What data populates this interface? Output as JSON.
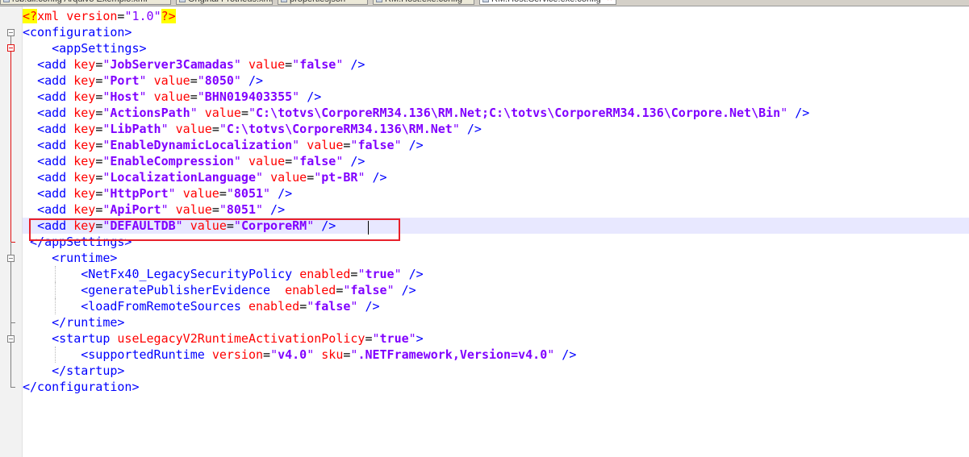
{
  "tabs": [
    {
      "label": "rsb.dll.config Arquivo Exemplo.xml",
      "active": false
    },
    {
      "label": "Original Protheus.xml",
      "active": false
    },
    {
      "label": "propertiesjson",
      "active": false
    },
    {
      "label": "RM.Host.exe.config",
      "active": false
    },
    {
      "label": "RM.Host.Service.exe.config",
      "active": true
    }
  ],
  "editor": {
    "decl": {
      "open": "<?",
      "name": "xml",
      "attr": "version",
      "value": "1.0",
      "close": "?>"
    },
    "lines": [
      {
        "indent": 0,
        "guides": [],
        "kind": "decl"
      },
      {
        "indent": 0,
        "guides": [],
        "kind": "tag",
        "text": "<configuration>"
      },
      {
        "indent": 4,
        "guides": [],
        "kind": "tag",
        "text": "<appSettings>"
      },
      {
        "indent": 2,
        "guides": [],
        "kind": "add",
        "key": "JobServer3Camadas",
        "value": "false"
      },
      {
        "indent": 2,
        "guides": [],
        "kind": "add",
        "key": "Port",
        "value": "8050"
      },
      {
        "indent": 2,
        "guides": [],
        "kind": "add",
        "key": "Host",
        "value": "BHN019403355"
      },
      {
        "indent": 2,
        "guides": [],
        "kind": "add",
        "key": "ActionsPath",
        "value": "C:\\totvs\\CorporeRM34.136\\RM.Net;C:\\totvs\\CorporeRM34.136\\Corpore.Net\\Bin"
      },
      {
        "indent": 2,
        "guides": [],
        "kind": "add",
        "key": "LibPath",
        "value": "C:\\totvs\\CorporeRM34.136\\RM.Net"
      },
      {
        "indent": 2,
        "guides": [],
        "kind": "add",
        "key": "EnableDynamicLocalization",
        "value": "false"
      },
      {
        "indent": 2,
        "guides": [],
        "kind": "add",
        "key": "EnableCompression",
        "value": "false"
      },
      {
        "indent": 2,
        "guides": [],
        "kind": "add",
        "key": "LocalizationLanguage",
        "value": "pt-BR"
      },
      {
        "indent": 2,
        "guides": [],
        "kind": "add",
        "key": "HttpPort",
        "value": "8051"
      },
      {
        "indent": 2,
        "guides": [],
        "kind": "add",
        "key": "ApiPort",
        "value": "8051"
      },
      {
        "indent": 2,
        "guides": [],
        "kind": "add",
        "key": "DEFAULTDB",
        "value": "CorporeRM",
        "current": true
      },
      {
        "indent": 1,
        "guides": [],
        "kind": "tag",
        "text": "</appSettings>"
      },
      {
        "indent": 4,
        "guides": [],
        "kind": "tag",
        "text": "<runtime>"
      },
      {
        "indent": 8,
        "guides": [
          4
        ],
        "kind": "enabled",
        "name": "NetFx40_LegacySecurityPolicy",
        "sep": " ",
        "value": "true"
      },
      {
        "indent": 8,
        "guides": [
          4
        ],
        "kind": "enabled",
        "name": "generatePublisherEvidence",
        "sep": "  ",
        "value": "false"
      },
      {
        "indent": 8,
        "guides": [
          4
        ],
        "kind": "enabled",
        "name": "loadFromRemoteSources",
        "sep": " ",
        "value": "false"
      },
      {
        "indent": 4,
        "guides": [],
        "kind": "tag",
        "text": "</runtime>"
      },
      {
        "indent": 4,
        "guides": [],
        "kind": "startup",
        "name": "startup",
        "attr": "useLegacyV2RuntimeActivationPolicy",
        "value": "true"
      },
      {
        "indent": 8,
        "guides": [
          4
        ],
        "kind": "supported",
        "name": "supportedRuntime",
        "attr1": "version",
        "val1": "v4.0",
        "attr2": "sku",
        "val2": ".NETFramework,Version=v4.0"
      },
      {
        "indent": 4,
        "guides": [],
        "kind": "tag",
        "text": "</startup>"
      },
      {
        "indent": 0,
        "guides": [],
        "kind": "tag",
        "text": "</configuration>"
      }
    ]
  },
  "colors": {
    "tag": "#0000ff",
    "attribute": "#ff0000",
    "value": "#8000ff",
    "annotation": "#e8202a",
    "current_line": "#e8e8ff"
  }
}
